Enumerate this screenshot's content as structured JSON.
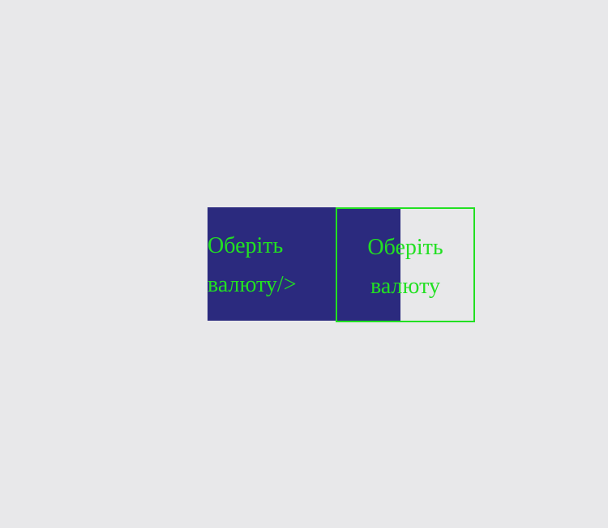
{
  "colors": {
    "background": "#e8e8ea",
    "panel": "#2b2a7e",
    "text": "#22e022",
    "border": "#22e022"
  },
  "left_panel": {
    "line1": "Оберіть",
    "line2": "валюту/>"
  },
  "currency_button": {
    "line1": "Оберіть",
    "line2": "валюту"
  }
}
